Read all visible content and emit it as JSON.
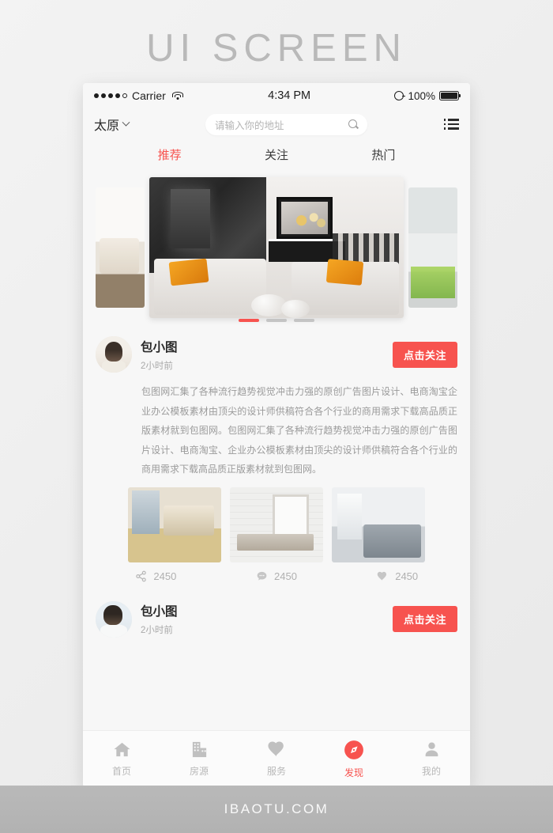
{
  "page": {
    "title": "UI SCREEN",
    "footer_text": "IBAOTU.COM",
    "accent_color": "#f7534f"
  },
  "statusbar": {
    "carrier": "Carrier",
    "time": "4:34 PM",
    "battery_pct": "100%",
    "signal_dots_filled": 4,
    "signal_dots_total": 5
  },
  "nav": {
    "city": "太原",
    "search_placeholder": "请输入你的地址",
    "search_value": ""
  },
  "tabs": [
    {
      "label": "推荐",
      "active": true
    },
    {
      "label": "关注",
      "active": false
    },
    {
      "label": "热门",
      "active": false
    }
  ],
  "carousel": {
    "slides": 3,
    "active_index": 0
  },
  "posts": [
    {
      "author": "包小图",
      "time": "2小时前",
      "follow_label": "点击关注",
      "body": "包图网汇集了各种流行趋势视觉冲击力强的原创广告图片设计、电商淘宝企业办公模板素材由顶尖的设计师供稿符合各个行业的商用需求下载高品质正版素材就到包图网。包图网汇集了各种流行趋势视觉冲击力强的原创广告图片设计、电商淘宝、企业办公模板素材由顶尖的设计师供稿符合各个行业的商用需求下载高品质正版素材就到包图网。",
      "actions": [
        {
          "icon": "share-icon",
          "count": "2450"
        },
        {
          "icon": "comment-icon",
          "count": "2450"
        },
        {
          "icon": "heart-icon",
          "count": "2450"
        }
      ]
    },
    {
      "author": "包小图",
      "time": "2小时前",
      "follow_label": "点击关注"
    }
  ],
  "tabbar": [
    {
      "label": "首页",
      "icon": "home-icon",
      "active": false
    },
    {
      "label": "房源",
      "icon": "building-icon",
      "active": false
    },
    {
      "label": "服务",
      "icon": "heart-icon",
      "active": false
    },
    {
      "label": "发现",
      "icon": "compass-icon",
      "active": true
    },
    {
      "label": "我的",
      "icon": "person-icon",
      "active": false
    }
  ]
}
